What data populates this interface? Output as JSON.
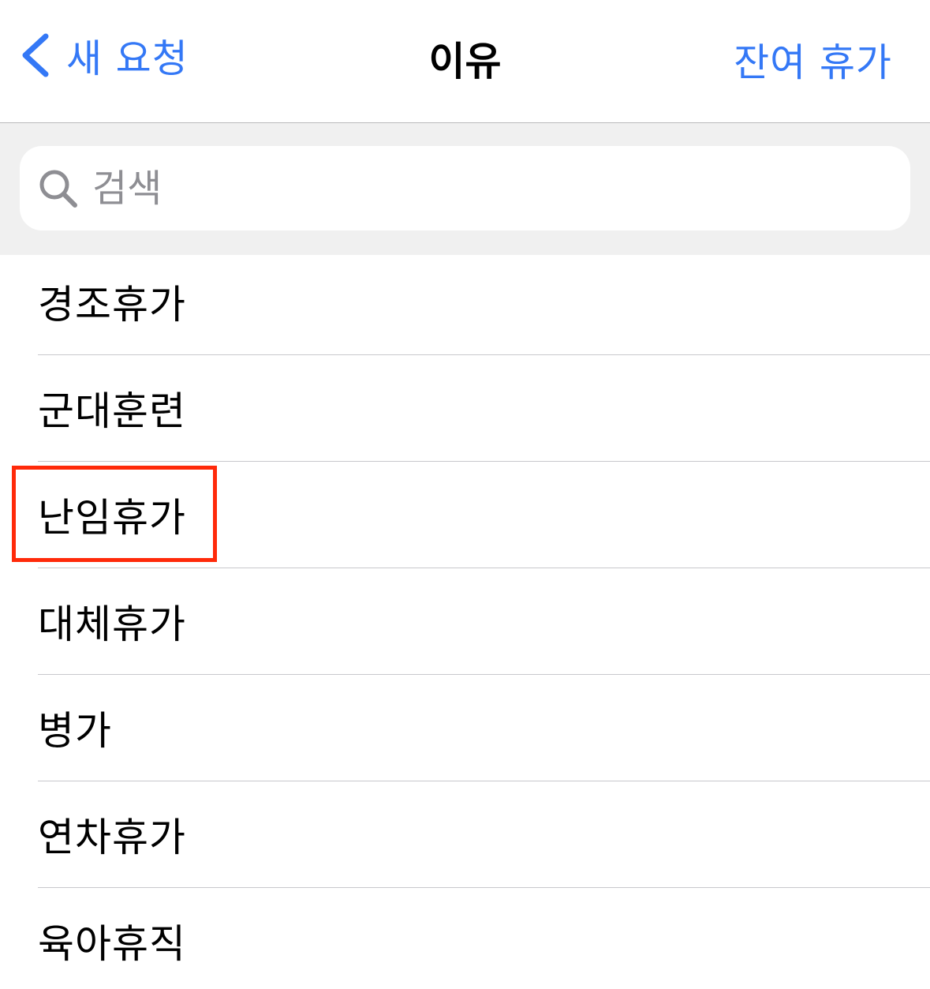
{
  "nav": {
    "back_label": "새 요청",
    "title": "이유",
    "right_label": "잔여 휴가"
  },
  "search": {
    "placeholder": "검색",
    "value": ""
  },
  "list": {
    "items": [
      {
        "label": "경조휴가"
      },
      {
        "label": "군대훈련"
      },
      {
        "label": "난임휴가"
      },
      {
        "label": "대체휴가"
      },
      {
        "label": "병가"
      },
      {
        "label": "연차휴가"
      },
      {
        "label": "육아휴직"
      }
    ],
    "highlighted_index": 2
  },
  "colors": {
    "accent": "#3478f6",
    "highlight": "#ff2a0a",
    "search_background": "#f0f0f0",
    "placeholder": "#8e8e93"
  },
  "icons": {
    "back": "chevron-left-icon",
    "search": "search-icon"
  }
}
